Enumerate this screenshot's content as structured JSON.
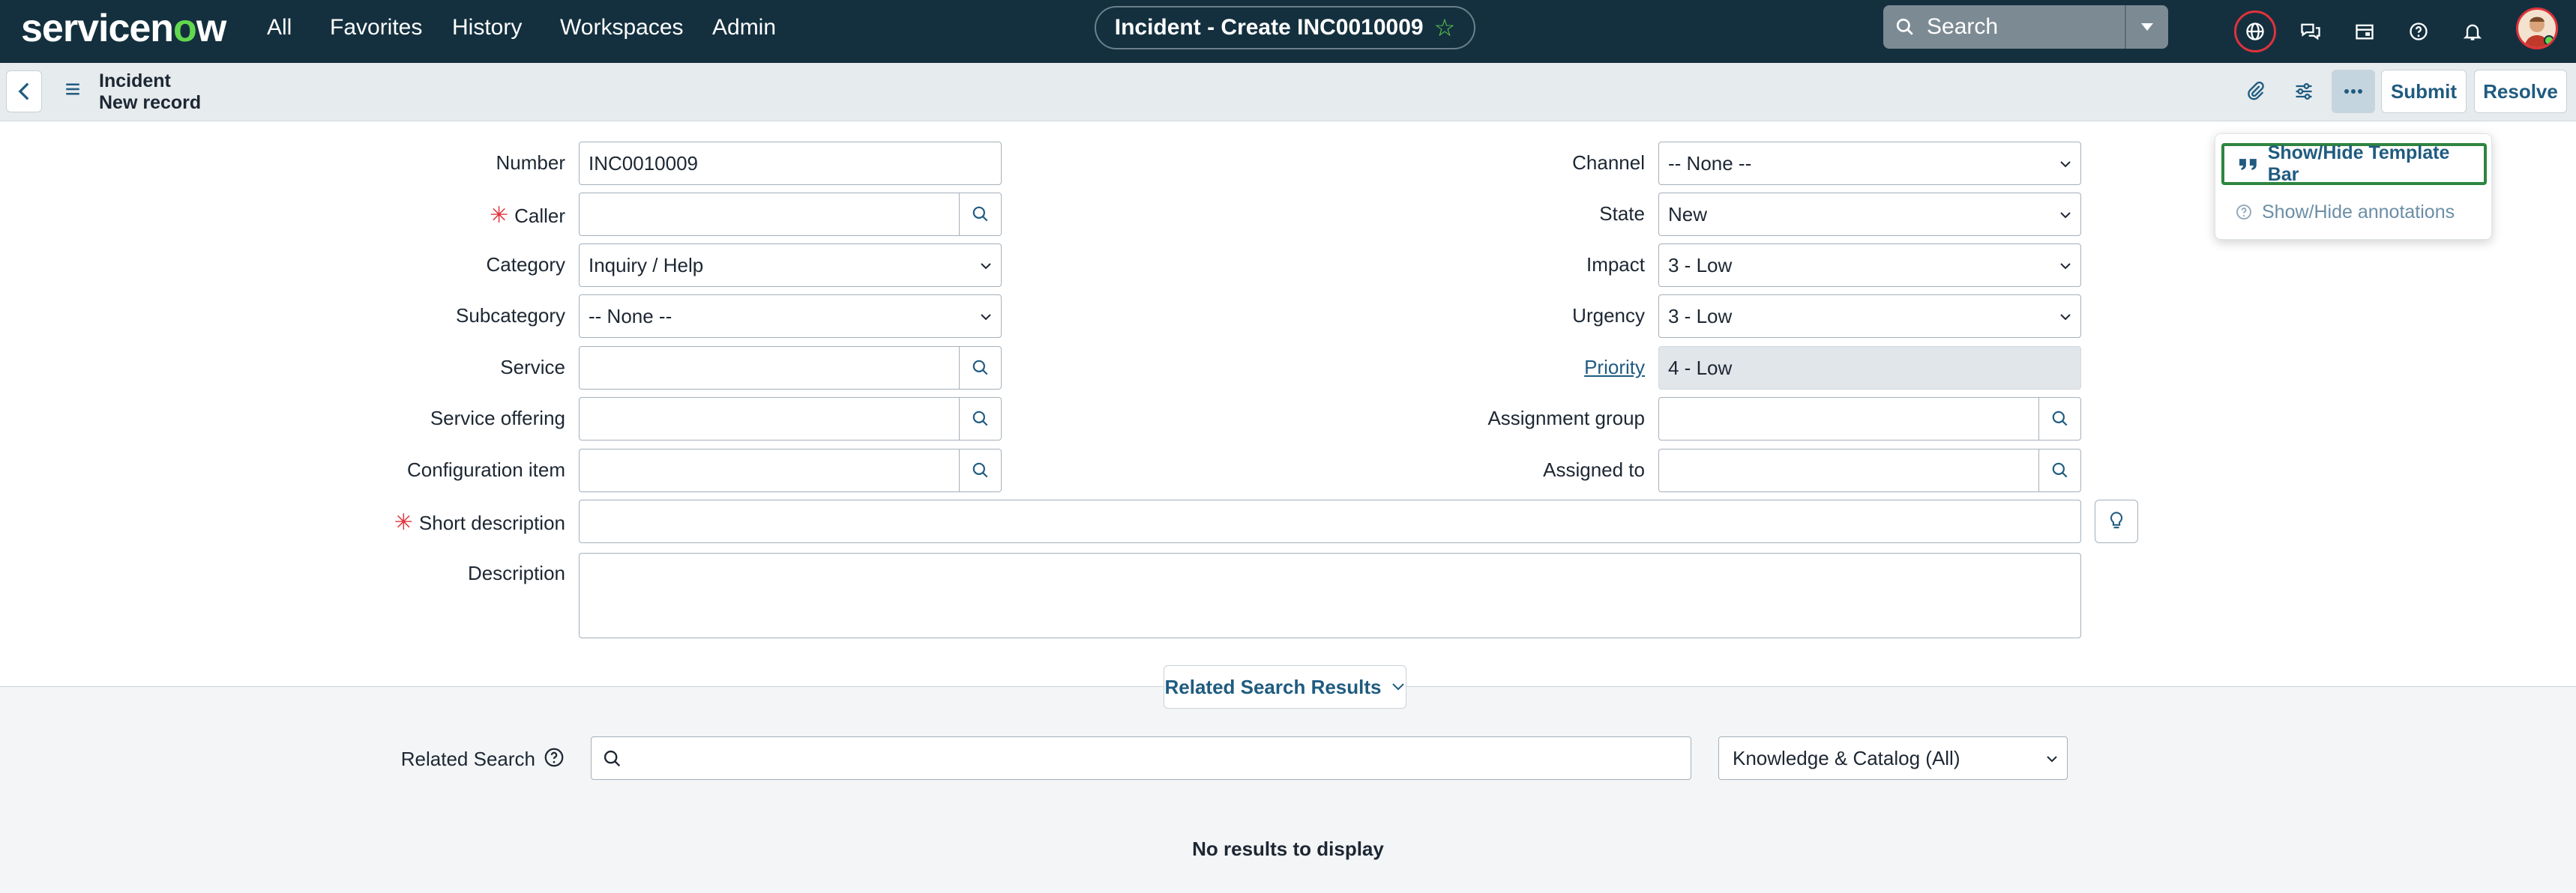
{
  "colors": {
    "nav_bg": "#14303f",
    "accent_green": "#62d84e",
    "link_blue": "#1f5b80",
    "required_red": "#e0323b",
    "highlight_green": "#2e8540"
  },
  "nav": {
    "logo_prefix": "servicen",
    "logo_o": "o",
    "logo_suffix": "w",
    "items": [
      "All",
      "Favorites",
      "History",
      "Workspaces",
      "Admin"
    ],
    "record_pill": "Incident - Create INC0010009",
    "search_placeholder": "Search",
    "icons": [
      "globe-icon",
      "chat-icon",
      "calendar-icon",
      "help-icon",
      "bell-icon"
    ]
  },
  "header": {
    "title": "Incident",
    "subtitle": "New record",
    "submit_label": "Submit",
    "resolve_label": "Resolve"
  },
  "menu": {
    "items": [
      "Show/Hide Template Bar",
      "Show/Hide annotations"
    ]
  },
  "form": {
    "number": {
      "label": "Number",
      "value": "INC0010009"
    },
    "caller": {
      "label": "Caller",
      "value": ""
    },
    "category": {
      "label": "Category",
      "value": "Inquiry / Help"
    },
    "subcategory": {
      "label": "Subcategory",
      "value": "-- None --"
    },
    "service": {
      "label": "Service",
      "value": ""
    },
    "service_offering": {
      "label": "Service offering",
      "value": ""
    },
    "configuration_item": {
      "label": "Configuration item",
      "value": ""
    },
    "short_description": {
      "label": "Short description",
      "value": ""
    },
    "description": {
      "label": "Description",
      "value": ""
    },
    "channel": {
      "label": "Channel",
      "value": "-- None --"
    },
    "state": {
      "label": "State",
      "value": "New"
    },
    "impact": {
      "label": "Impact",
      "value": "3 - Low"
    },
    "urgency": {
      "label": "Urgency",
      "value": "3 - Low"
    },
    "priority": {
      "label": "Priority",
      "value": "4 - Low"
    },
    "assignment_group": {
      "label": "Assignment group",
      "value": ""
    },
    "assigned_to": {
      "label": "Assigned to",
      "value": ""
    }
  },
  "related": {
    "toggle_label": "Related Search Results",
    "search_label": "Related Search",
    "search_value": "",
    "scope_value": "Knowledge & Catalog (All)",
    "empty_text": "No results to display"
  }
}
